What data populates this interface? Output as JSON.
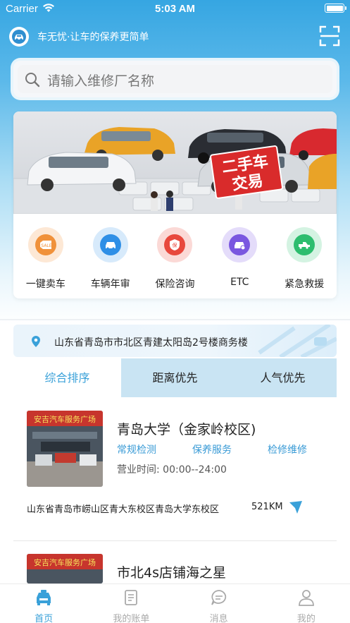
{
  "status_bar": {
    "carrier": "Carrier",
    "time": "5:03 AM"
  },
  "header": {
    "slogan": "车无忧·让车的保养更简单",
    "logo_icon": "car-logo-icon",
    "scan_icon": "scan-icon"
  },
  "search": {
    "placeholder": "请输入维修厂名称"
  },
  "banner": {
    "sign_line1": "二手车",
    "sign_line2": "交易"
  },
  "quick_menu": [
    {
      "label": "一键卖车",
      "icon": "sale-tag-icon",
      "color": "#f0913a",
      "halo": "#fde8d5"
    },
    {
      "label": "车辆年审",
      "icon": "car-inspection-icon",
      "color": "#2f8fe6",
      "halo": "#d7eafb"
    },
    {
      "label": "保险咨询",
      "icon": "insurance-shield-icon",
      "color": "#e8473c",
      "halo": "#fbd9d6"
    },
    {
      "label": "ETC",
      "icon": "etc-car-icon",
      "color": "#7a57e0",
      "halo": "#e4dcfa"
    },
    {
      "label": "紧急救援",
      "icon": "tow-truck-icon",
      "color": "#2dbd6e",
      "halo": "#d4f3e2"
    }
  ],
  "location": {
    "address": "山东省青岛市市北区青建太阳岛2号楼商务楼"
  },
  "sort_tabs": [
    {
      "label": "综合排序",
      "active": true
    },
    {
      "label": "距离优先",
      "active": false
    },
    {
      "label": "人气优先",
      "active": false
    }
  ],
  "shops": [
    {
      "name": "青岛大学（金家岭校区)",
      "tags": [
        "常规检测",
        "保养服务",
        "检修维修"
      ],
      "hours": "营业时间: 00:00--24:00",
      "address": "山东省青岛市崂山区青大东校区青岛大学东校区",
      "distance": "521KM",
      "sign_text": "安吉汽车服务广场"
    },
    {
      "name": "市北4s店铺海之星",
      "sign_text": "安吉汽车服务广场"
    }
  ],
  "tab_bar": [
    {
      "label": "首页",
      "icon": "home-car-icon",
      "active": true
    },
    {
      "label": "我的账单",
      "icon": "bill-icon",
      "active": false
    },
    {
      "label": "消息",
      "icon": "message-icon",
      "active": false
    },
    {
      "label": "我的",
      "icon": "user-icon",
      "active": false
    }
  ],
  "colors": {
    "primary": "#3aa1d9",
    "header_gradient_top": "#36a6e2"
  }
}
